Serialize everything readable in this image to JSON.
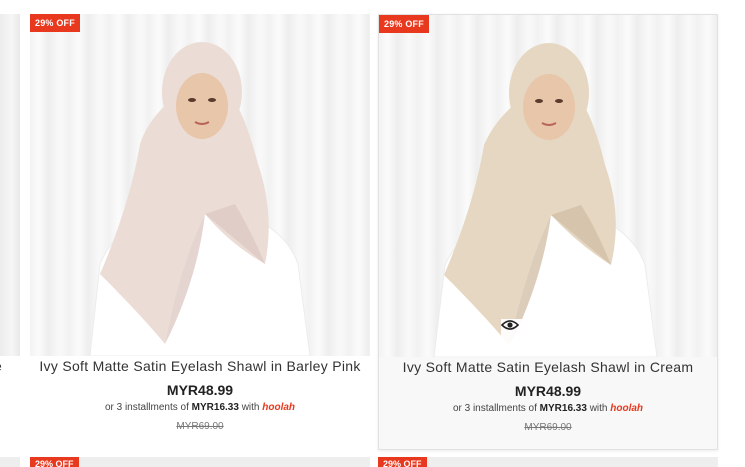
{
  "edge_product": {
    "title_fragment": "e"
  },
  "products": [
    {
      "badge": "29% OFF",
      "title": "Ivy Soft Matte Satin Eyelash Shawl in Barley Pink",
      "price": "MYR48.99",
      "install_prefix": "or 3 installments of",
      "install_amount": "MYR16.33",
      "install_with": "with",
      "install_brand": "hoolah",
      "compare_price": "MYR69.00",
      "shawl_color": "#ecdcd6",
      "shawl_shade": "#d9c3bc",
      "quick_view": false
    },
    {
      "badge": "29% OFF",
      "title": "Ivy Soft Matte Satin Eyelash Shawl in Cream",
      "price": "MYR48.99",
      "install_prefix": "or 3 installments of",
      "install_amount": "MYR16.33",
      "install_with": "with",
      "install_brand": "hoolah",
      "compare_price": "MYR69.00",
      "shawl_color": "#e6d7c2",
      "shawl_shade": "#cdb89d",
      "quick_view": true,
      "quick_view_icon": "eye-icon"
    }
  ],
  "next_row": {
    "badges": [
      "29% OFF",
      "29% OFF"
    ]
  },
  "colors": {
    "badge_bg": "#e8381e",
    "hoolah_brand": "#e8381e"
  }
}
